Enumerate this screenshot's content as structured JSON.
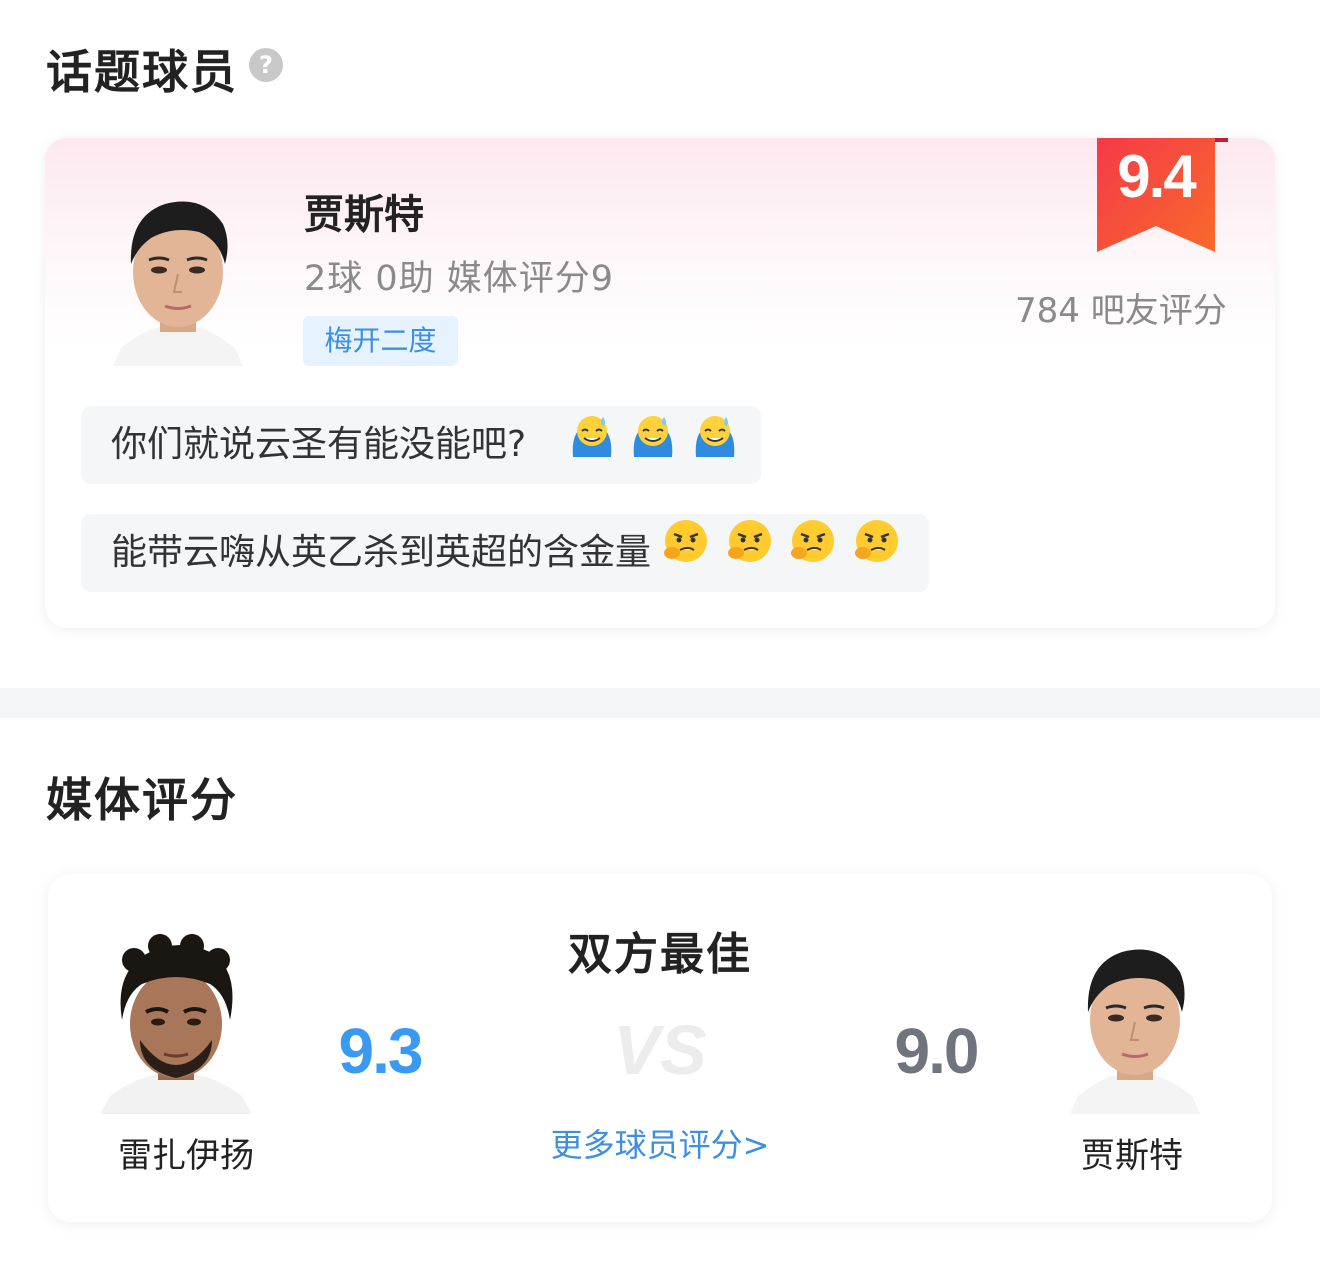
{
  "topic_section": {
    "title": "话题球员",
    "help_icon": "question-circle-icon",
    "player": {
      "name": "贾斯特",
      "stats": "2球 0助  媒体评分9",
      "tag": "梅开二度",
      "rating": "9.4",
      "fan_rating_text": "784 吧友评分",
      "badge_color": "#f0383e"
    },
    "comments": [
      {
        "text": "你们就说云圣有能没能吧?",
        "emojis": [
          "sweat-smile-emoji",
          "sweat-smile-emoji",
          "sweat-smile-emoji"
        ]
      },
      {
        "text": "能带云嗨从英乙杀到英超的含金量",
        "emojis": [
          "thinking-face-emoji",
          "thinking-face-emoji",
          "thinking-face-emoji",
          "thinking-face-emoji"
        ]
      }
    ]
  },
  "media_section": {
    "title": "媒体评分",
    "best_title": "双方最佳",
    "vs_text": "VS",
    "more_link": "更多球员评分>",
    "left_player": {
      "name": "雷扎伊扬",
      "score": "9.3",
      "score_color": "#3a9af2"
    },
    "right_player": {
      "name": "贾斯特",
      "score": "9.0",
      "score_color": "#70757d"
    }
  }
}
